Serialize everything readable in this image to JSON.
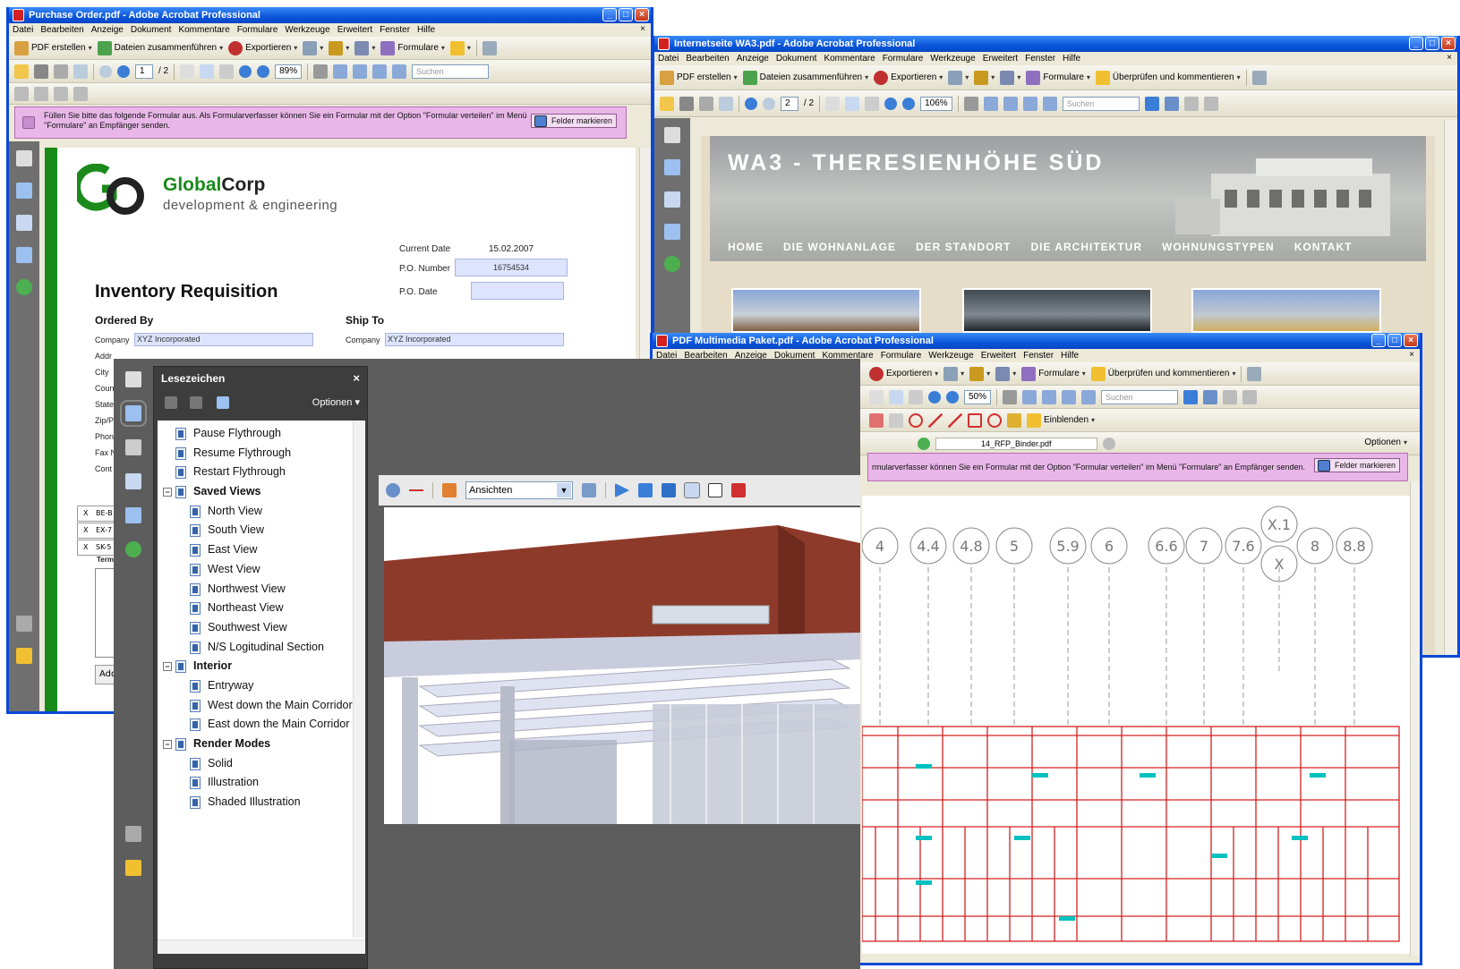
{
  "w1": {
    "title": "Purchase Order.pdf - Adobe Acrobat Professional",
    "menu": [
      "Datei",
      "Bearbeiten",
      "Anzeige",
      "Dokument",
      "Kommentare",
      "Formulare",
      "Werkzeuge",
      "Erweitert",
      "Fenster",
      "Hilfe"
    ],
    "tb1": {
      "pdf": "PDF erstellen",
      "merge": "Dateien zusammenführen",
      "export": "Exportieren",
      "forms": "Formulare"
    },
    "page_current": "1",
    "page_total": "/ 2",
    "zoom": "89%",
    "search_placeholder": "Suchen",
    "formbar_text": "Füllen Sie bitte das folgende Formular aus. Als Formularverfasser können Sie ein Formular mit der Option \"Formular verteilen\" im Menü \"Formulare\" an Empfänger senden.",
    "formbar_button": "Felder markieren",
    "doc": {
      "company_name_a": "Global",
      "company_name_b": "Corp",
      "company_sub": "development & engineering",
      "current_date_label": "Current Date",
      "current_date": "15.02.2007",
      "po_number_label": "P.O. Number",
      "po_number": "16754534",
      "po_date_label": "P.O. Date",
      "heading": "Inventory Requisition",
      "ordered_by": "Ordered By",
      "ship_to": "Ship To",
      "company_label": "Company",
      "company_value": "XYZ Incorporated",
      "ship_company_label": "Company",
      "ship_company_value": "XYZ Incorporated",
      "partial_labels": [
        "Addr",
        "City",
        "Coun",
        "State",
        "Zip/P",
        "Phon",
        "Fax N",
        "Cont"
      ],
      "rows": [
        {
          "x": "X",
          "code": "BE-B"
        },
        {
          "x": "X",
          "code": "EX-7"
        },
        {
          "x": "X",
          "code": "SK-5"
        }
      ],
      "terms_partial": "Term",
      "add_partial": "Add"
    }
  },
  "w2": {
    "title": "Internetseite WA3.pdf - Adobe Acrobat Professional",
    "menu": [
      "Datei",
      "Bearbeiten",
      "Anzeige",
      "Dokument",
      "Kommentare",
      "Formulare",
      "Werkzeuge",
      "Erweitert",
      "Fenster",
      "Hilfe"
    ],
    "tb1": {
      "pdf": "PDF erstellen",
      "merge": "Dateien zusammenführen",
      "export": "Exportieren",
      "forms": "Formulare",
      "review": "Überprüfen und kommentieren"
    },
    "page_current": "2",
    "page_total": "/ 2",
    "zoom": "106%",
    "search_placeholder": "Suchen",
    "site_title": "WA3 - THERESIENHÖHE SÜD",
    "nav": [
      "HOME",
      "DIE WOHNANLAGE",
      "DER STANDORT",
      "DIE ARCHITEKTUR",
      "WOHNUNGSTYPEN",
      "KONTAKT"
    ]
  },
  "w3": {
    "title": "PDF Multimedia Paket.pdf - Adobe Acrobat Professional",
    "menu": [
      "Datei",
      "Bearbeiten",
      "Anzeige",
      "Dokument",
      "Kommentare",
      "Formulare",
      "Werkzeuge",
      "Erweitert",
      "Fenster",
      "Hilfe"
    ],
    "tb1": {
      "export": "Exportieren",
      "forms": "Formulare",
      "review": "Überprüfen und kommentieren"
    },
    "zoom": "50%",
    "search_placeholder": "Suchen",
    "comment_show": "Einblenden",
    "file_name": "14_RFP_Binder.pdf",
    "options": "Optionen",
    "formbar_text": "rmularverfasser können Sie ein Formular mit der Option \"Formular verteilen\" im Menü \"Formulare\" an Empfänger senden.",
    "formbar_button": "Felder markieren",
    "grid_labels": [
      "4",
      "4.4",
      "4.8",
      "5",
      "5.9",
      "6",
      "6.6",
      "7",
      "7.6",
      "X.1",
      "X",
      "8",
      "8.8"
    ]
  },
  "bookmarks": {
    "title": "Lesezeichen",
    "close": "×",
    "options": "Optionen",
    "items": [
      {
        "label": "Pause Flythrough",
        "level": 0,
        "group": false
      },
      {
        "label": "Resume Flythrough",
        "level": 0,
        "group": false
      },
      {
        "label": "Restart Flythrough",
        "level": 0,
        "group": false
      },
      {
        "label": "Saved Views",
        "level": 0,
        "group": true
      },
      {
        "label": "North View",
        "level": 1,
        "group": false
      },
      {
        "label": "South View",
        "level": 1,
        "group": false
      },
      {
        "label": "East View",
        "level": 1,
        "group": false
      },
      {
        "label": "West View",
        "level": 1,
        "group": false
      },
      {
        "label": "Northwest View",
        "level": 1,
        "group": false
      },
      {
        "label": "Northeast View",
        "level": 1,
        "group": false
      },
      {
        "label": "Southwest View",
        "level": 1,
        "group": false
      },
      {
        "label": "N/S Logitudinal Section",
        "level": 1,
        "group": false
      },
      {
        "label": "Interior",
        "level": 0,
        "group": true
      },
      {
        "label": "Entryway",
        "level": 1,
        "group": false
      },
      {
        "label": "West down the Main Corridor",
        "level": 1,
        "group": false
      },
      {
        "label": "East down the Main Corridor",
        "level": 1,
        "group": false
      },
      {
        "label": "Render Modes",
        "level": 0,
        "group": true
      },
      {
        "label": "Solid",
        "level": 1,
        "group": false
      },
      {
        "label": "Illustration",
        "level": 1,
        "group": false
      },
      {
        "label": "Shaded Illustration",
        "level": 1,
        "group": false
      }
    ]
  },
  "viewer3d": {
    "views_select": "Ansichten"
  },
  "colors": {
    "xp_blue": "#0a48d8",
    "green_bar": "#178a17",
    "form_pink": "#e8b7e8",
    "brick": "#8e3a2a",
    "plan_red": "#d42020"
  }
}
